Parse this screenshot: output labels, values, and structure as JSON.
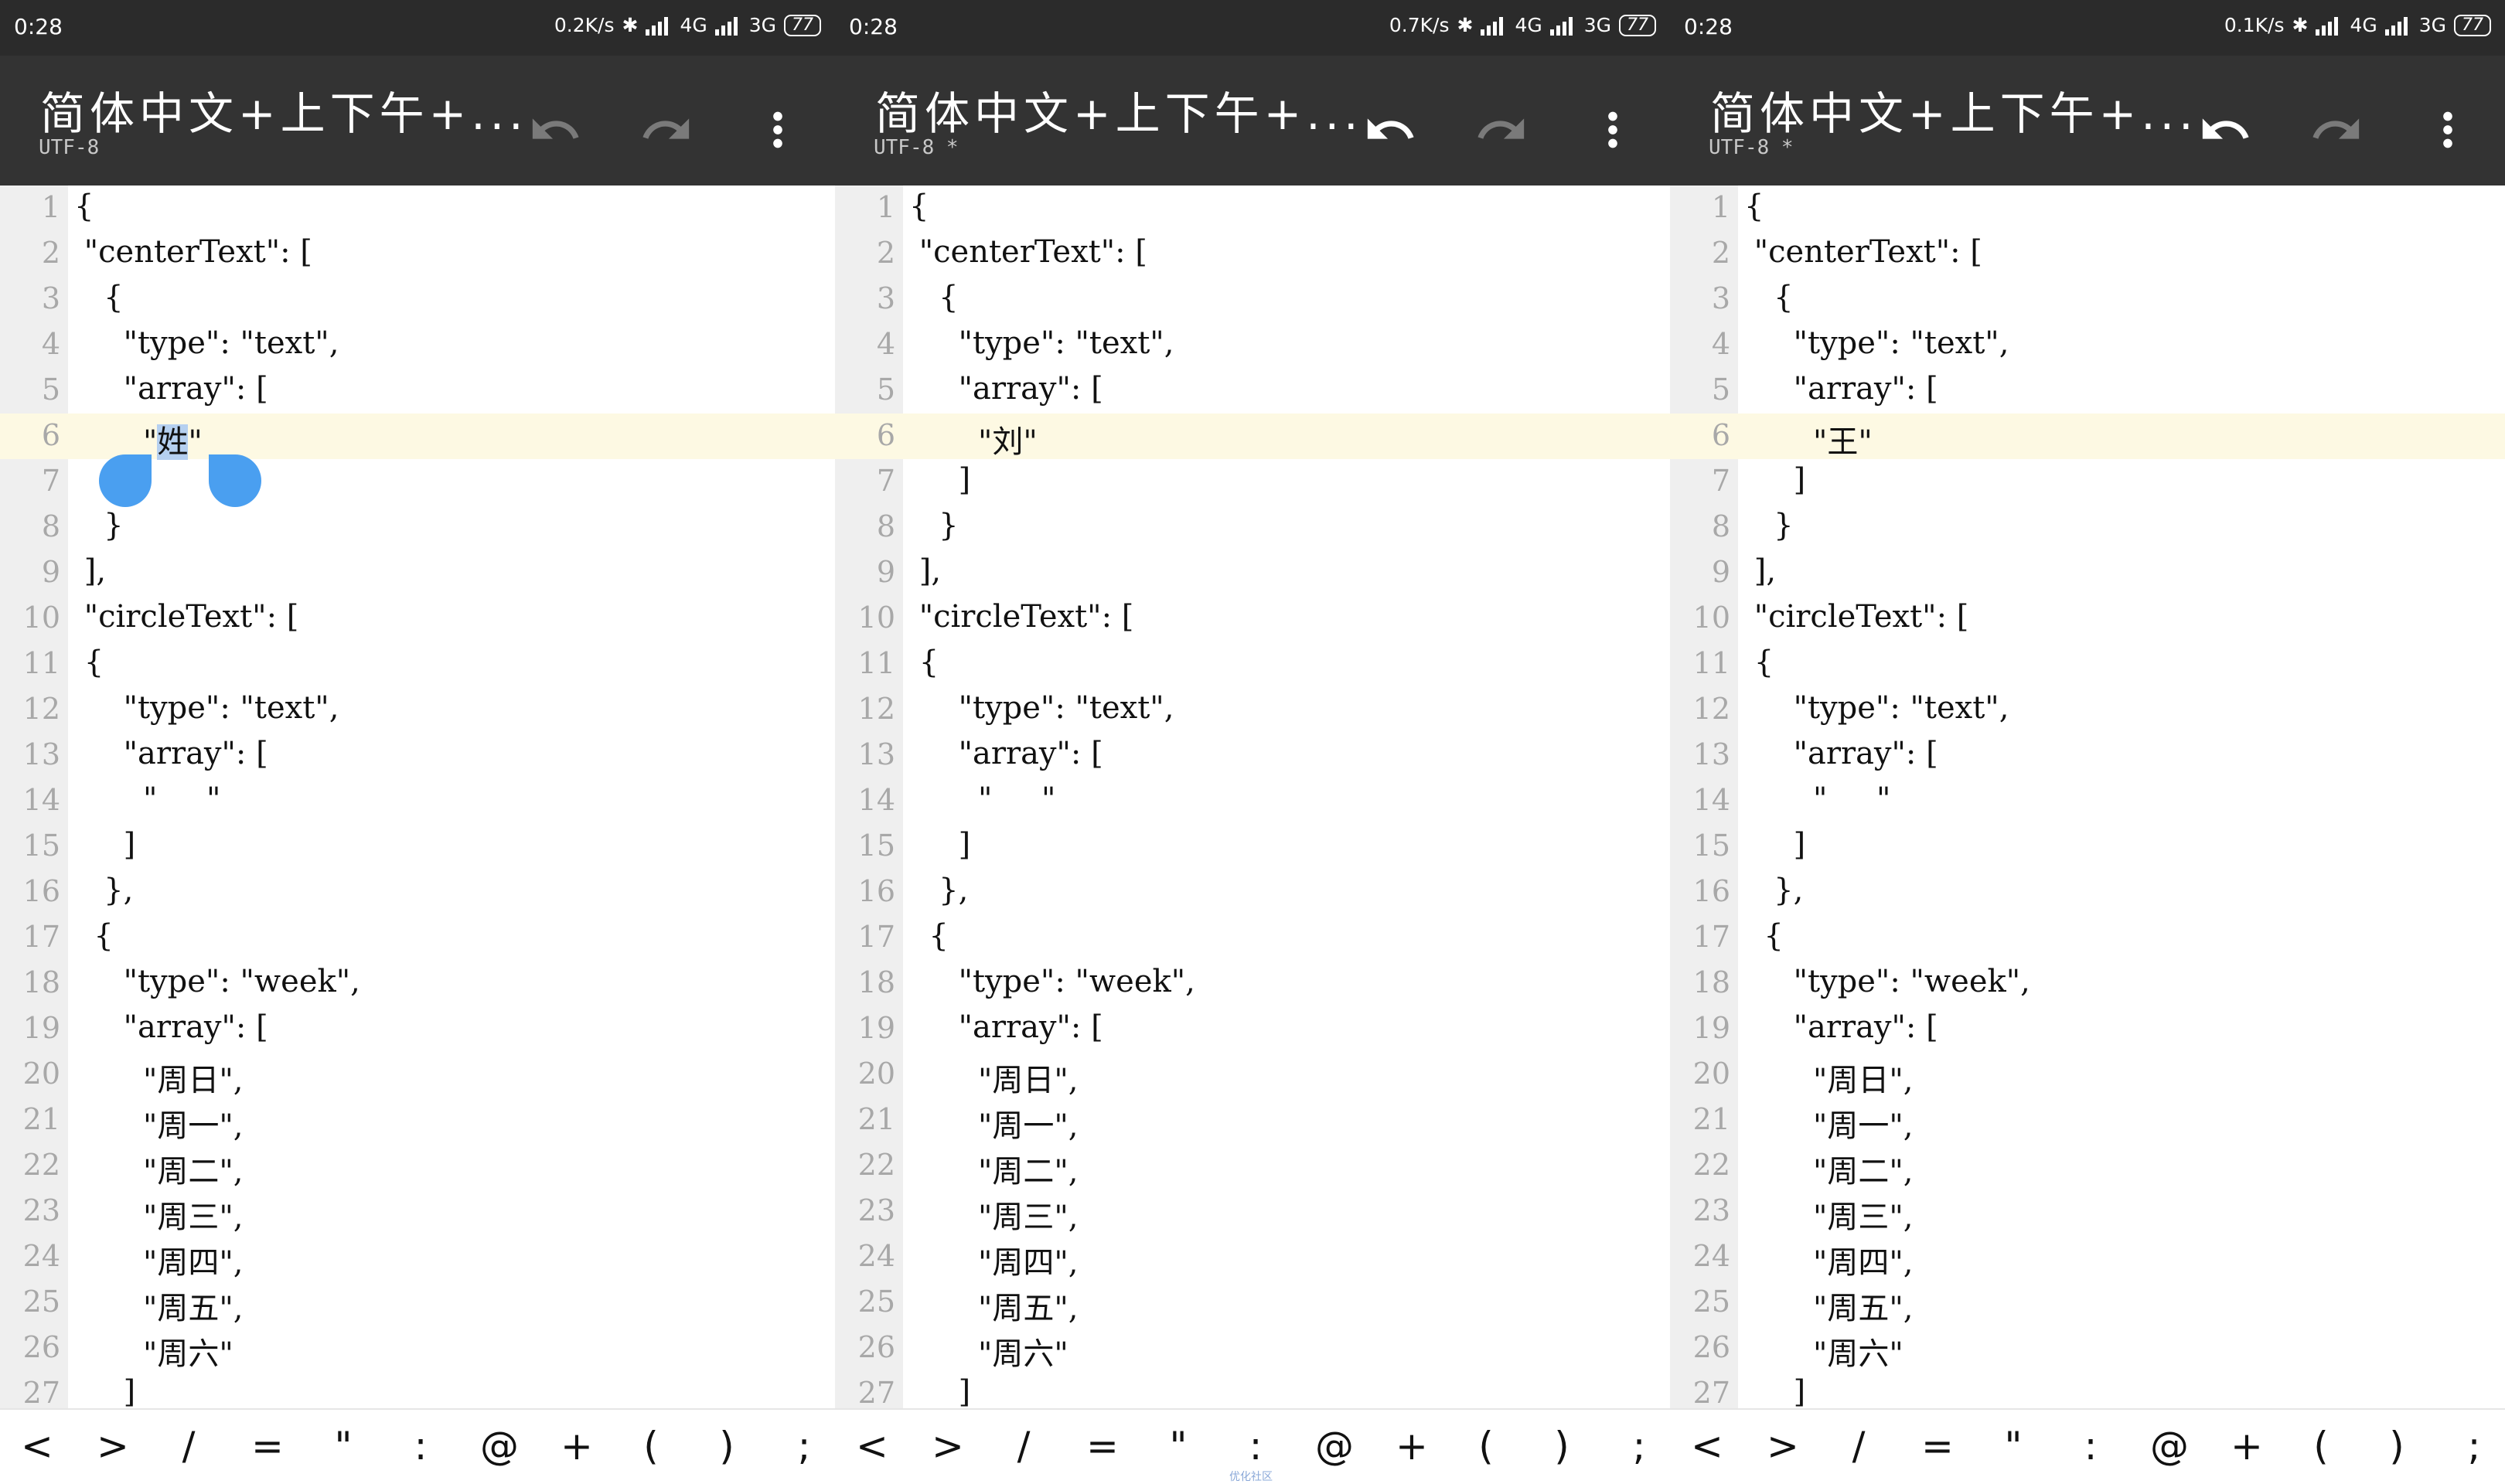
{
  "screens": [
    {
      "status": {
        "time": "0:28",
        "speed": "0.2K/s",
        "net1": "4G",
        "net2": "3G",
        "battery": "77"
      },
      "title": "简体中文+上下午+...",
      "subtitle": "UTF-8",
      "undo_enabled": false,
      "redo_enabled": false,
      "active_line": 6,
      "selection": {
        "line": 6,
        "text": "姓"
      },
      "lines": [
        "{",
        " \"centerText\": [",
        "   {",
        "     \"type\": \"text\",",
        "     \"array\": [",
        "       \"姓\"",
        "     ]",
        "   }",
        " ],",
        " \"circleText\": [",
        " {",
        "     \"type\": \"text\",",
        "     \"array\": [",
        "       \"     \"",
        "     ]",
        "   },",
        "  {",
        "     \"type\": \"week\",",
        "     \"array\": [",
        "       \"周日\",",
        "       \"周一\",",
        "       \"周二\",",
        "       \"周三\",",
        "       \"周四\",",
        "       \"周五\",",
        "       \"周六\"",
        "     ]"
      ]
    },
    {
      "status": {
        "time": "0:28",
        "speed": "0.7K/s",
        "net1": "4G",
        "net2": "3G",
        "battery": "77"
      },
      "title": "简体中文+上下午+...",
      "subtitle": "UTF-8 *",
      "undo_enabled": true,
      "redo_enabled": false,
      "active_line": 6,
      "lines": [
        "{",
        " \"centerText\": [",
        "   {",
        "     \"type\": \"text\",",
        "     \"array\": [",
        "       \"刘\"",
        "     ]",
        "   }",
        " ],",
        " \"circleText\": [",
        " {",
        "     \"type\": \"text\",",
        "     \"array\": [",
        "       \"     \"",
        "     ]",
        "   },",
        "  {",
        "     \"type\": \"week\",",
        "     \"array\": [",
        "       \"周日\",",
        "       \"周一\",",
        "       \"周二\",",
        "       \"周三\",",
        "       \"周四\",",
        "       \"周五\",",
        "       \"周六\"",
        "     ]"
      ]
    },
    {
      "status": {
        "time": "0:28",
        "speed": "0.1K/s",
        "net1": "4G",
        "net2": "3G",
        "battery": "77"
      },
      "title": "简体中文+上下午+...",
      "subtitle": "UTF-8 *",
      "undo_enabled": true,
      "redo_enabled": false,
      "active_line": 6,
      "lines": [
        "{",
        " \"centerText\": [",
        "   {",
        "     \"type\": \"text\",",
        "     \"array\": [",
        "       \"王\"",
        "     ]",
        "   }",
        " ],",
        " \"circleText\": [",
        " {",
        "     \"type\": \"text\",",
        "     \"array\": [",
        "       \"     \"",
        "     ]",
        "   },",
        "  {",
        "     \"type\": \"week\",",
        "     \"array\": [",
        "       \"周日\",",
        "       \"周一\",",
        "       \"周二\",",
        "       \"周三\",",
        "       \"周四\",",
        "       \"周五\",",
        "       \"周六\"",
        "     ]"
      ]
    }
  ],
  "symbols": [
    "<",
    ">",
    "/",
    "=",
    "\"",
    ":",
    "@",
    "+",
    "(",
    ")",
    ";"
  ],
  "watermark": "优化社区",
  "colors": {
    "toolbar": "#333333",
    "statusbar": "#2b2b2b",
    "active_line": "#fdf9e3",
    "selection": "#b5d0f0",
    "handle": "#4a9ff0"
  },
  "icons": [
    "undo-icon",
    "redo-icon",
    "more-vert-icon"
  ]
}
